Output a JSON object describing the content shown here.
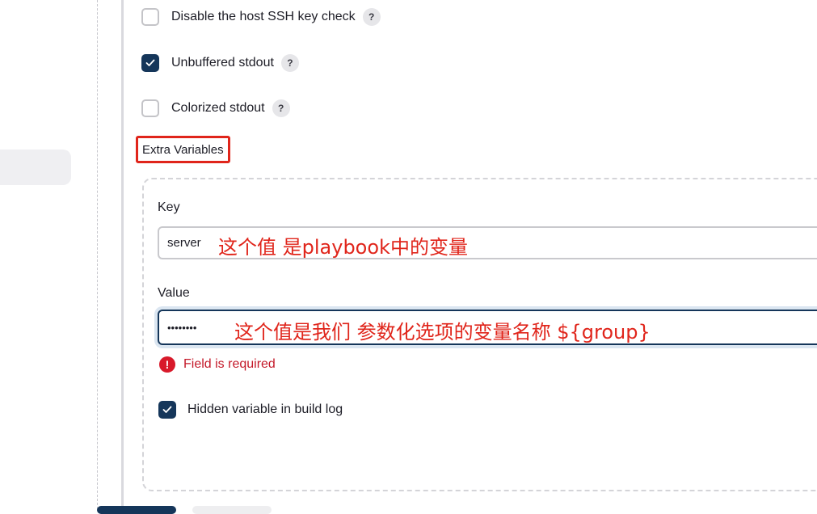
{
  "options": {
    "disable_ssh": {
      "label": "Disable the host SSH key check",
      "checked": false,
      "help": "?"
    },
    "unbuffered": {
      "label": "Unbuffered stdout",
      "checked": true,
      "help": "?"
    },
    "colorized": {
      "label": "Colorized stdout",
      "checked": false,
      "help": "?"
    }
  },
  "extra_variables": {
    "title": "Extra Variables",
    "key_label": "Key",
    "key_value": "server",
    "key_annotation": "这个值 是playbook中的变量",
    "value_label": "Value",
    "value_masked": "••••••••",
    "value_annotation": "这个值是我们 参数化选项的变量名称  ${group}",
    "error_icon": "!",
    "error_text": "Field is required",
    "hidden_label": "Hidden variable in build log",
    "hidden_checked": true
  },
  "colors": {
    "accent": "#15365a",
    "error": "#d8192a",
    "annotation": "#e0251b"
  },
  "icons": {
    "check": "checkmark-icon",
    "help": "help-icon",
    "error": "error-icon"
  }
}
